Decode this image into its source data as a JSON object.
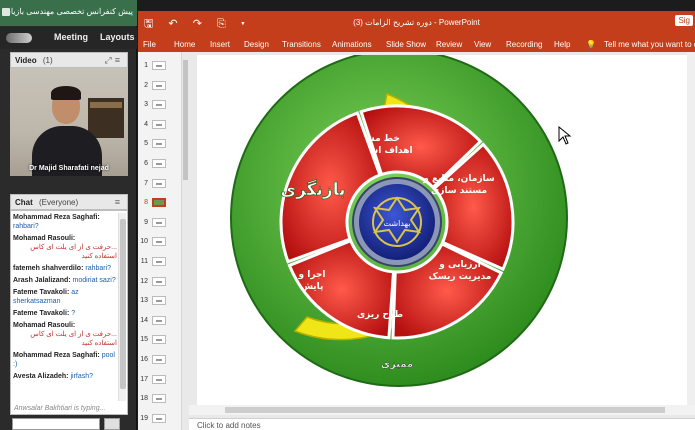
{
  "meeting": {
    "window_title": "پیش کنفرانس تخصصی مهندسی بازیابی آب، بهداشت و محیط زیست",
    "menu": [
      "Meeting",
      "Layouts"
    ],
    "video_pod": {
      "title": "Video",
      "count": "(1)",
      "participant": "Dr Majid Sharafati nejad"
    },
    "chat_pod": {
      "title": "Chat",
      "scope": "(Everyone)",
      "messages": [
        {
          "who": "Mohammad Reza Saghafi:",
          "text": "rahbari?",
          "rtl": false
        },
        {
          "who": "Mohamad Rasouli:",
          "text": "...حرفت ی از ای یلت ای کاس استفاده کنید",
          "rtl": true
        },
        {
          "who": "fatemeh shahverdilo:",
          "text": "rahbari?",
          "rtl": false
        },
        {
          "who": "Arash Jalalizand:",
          "text": "modiriat sazi?",
          "rtl": false
        },
        {
          "who": "Fateme Tavakoli:",
          "text": "az sherkatsazman",
          "rtl": false
        },
        {
          "who": "Fateme Tavakoli:",
          "text": "?",
          "rtl": false
        },
        {
          "who": "Mohamad Rasouli:",
          "text": "...حرفت ی از ای یلت ای کاس استفاده کنید",
          "rtl": true
        },
        {
          "who": "Mohammad Reza Saghafi:",
          "text": "pool :)",
          "rtl": false
        },
        {
          "who": "Avesta Alizadeh:",
          "text": "jirfash?",
          "rtl": false
        }
      ],
      "typing": "Anwsalar Bakhtiari is typing..."
    }
  },
  "ppt": {
    "qat": "🖫 ↶ ↷ ⎘ ▾",
    "title": "دوره تشریح الزامات (3) - PowerPoint",
    "signin": "Sig",
    "tabs": [
      "File",
      "Home",
      "Insert",
      "Design",
      "Transitions",
      "Animations",
      "Slide Show",
      "Review",
      "View",
      "Recording",
      "Help",
      "💡",
      "Tell me what you want to do"
    ],
    "slide_numbers": [
      "1",
      "2",
      "3",
      "4",
      "5",
      "6",
      "7",
      "8",
      "9",
      "10",
      "11",
      "12",
      "13",
      "14",
      "15",
      "16",
      "17",
      "18",
      "19"
    ],
    "selected_slide": "8",
    "notes_placeholder": "Click to add notes",
    "slide": {
      "outer_label": "بازنگری",
      "ring_label": "ممیزی",
      "segments": [
        "خط مشی و اهداف استراتژیک",
        "سازمان، منابع و مستند سازی",
        "ارزیابی و مدیریت ریسک",
        "طرح ریزی",
        "اجرا و پایش"
      ],
      "logo_text": "بهداشت",
      "colors": {
        "outer": "#3ea12c",
        "ring": "#f0e516",
        "segment": "#d81a1a",
        "logo": "#1a2c8f"
      }
    }
  }
}
